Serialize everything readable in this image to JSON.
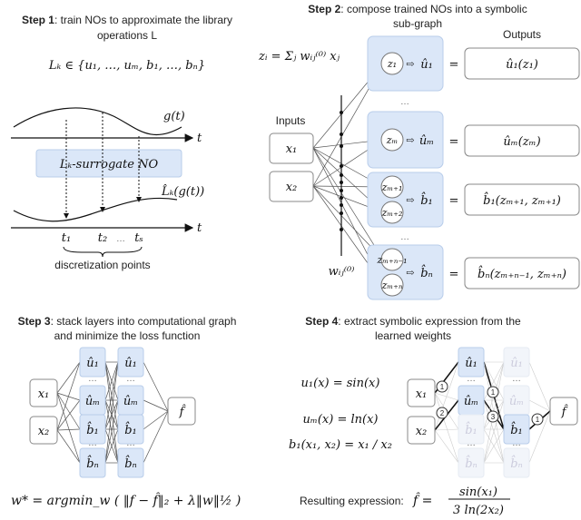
{
  "step1": {
    "title_bold": "Step 1",
    "title_rest": ": train NOs to approximate the library",
    "title_line2": "operations L",
    "library_set": "Lₖ ∈ {u₁, …, uₘ, b₁, …, bₙ}",
    "input_label": "g(t)",
    "axis_label": "t",
    "surrogate_label": "Lₖ-surrogate NO",
    "output_label": "L̂ₖ(g(t))",
    "ticks": [
      "t₁",
      "t₂",
      "…",
      "tₛ"
    ],
    "caption": "discretization points"
  },
  "step2": {
    "title_bold": "Step 2",
    "title_rest": ": compose trained NOs into a symbolic",
    "title_line2": "sub-graph",
    "formula": "zᵢ = Σⱼ wᵢⱼ⁽⁰⁾ xⱼ",
    "inputs_label": "Inputs",
    "outputs_label": "Outputs",
    "inputs": [
      "x₁",
      "x₂"
    ],
    "weight_label": "wᵢⱼ⁽⁰⁾",
    "ellipsis": "…",
    "equals": "=",
    "blocks": [
      {
        "nodes": [
          "z₁"
        ],
        "op": "û₁",
        "output": "û₁(z₁)"
      },
      {
        "nodes": [
          "zₘ"
        ],
        "op": "ûₘ",
        "output": "ûₘ(zₘ)"
      },
      {
        "nodes": [
          "zₘ₊₁",
          "zₘ₊₂"
        ],
        "op": "b̂₁",
        "output": "b̂₁(zₘ₊₁, zₘ₊₁)"
      },
      {
        "nodes": [
          "zₘ₊ₙ₋₁",
          "zₘ₊ₙ"
        ],
        "op": "b̂ₙ",
        "output": "b̂ₙ(zₘ₊ₙ₋₁, zₘ₊ₙ)"
      }
    ]
  },
  "step3": {
    "title_bold": "Step 3",
    "title_rest": ": stack layers into computational graph",
    "title_line2": "and minimize the loss function",
    "inputs": [
      "x₁",
      "x₂"
    ],
    "nodes": [
      "û₁",
      "…",
      "ûₘ",
      "b̂₁",
      "…",
      "b̂ₙ"
    ],
    "output": "f̂",
    "loss": "w* = argmin_w ( ‖f − f̂‖₂ + λ‖w‖½ )"
  },
  "step4": {
    "title_bold": "Step 4",
    "title_rest": ": extract symbolic expression from the",
    "title_line2": "learned weights",
    "equations": [
      "u₁(x) = sin(x)",
      "uₘ(x) = ln(x)",
      "b₁(x₁, x₂) = x₁ / x₂"
    ],
    "inputs": [
      "x₁",
      "x₂"
    ],
    "nodes": [
      "û₁",
      "…",
      "ûₘ",
      "b̂₁",
      "…",
      "b̂ₙ"
    ],
    "output": "f̂",
    "weights": [
      "1",
      "2",
      "1",
      "3",
      "1"
    ],
    "result_label": "Resulting expression:",
    "result_lhs": "f̂ =",
    "result_num": "sin(x₁)",
    "result_den": "3 ln(2x₂)"
  },
  "colors": {
    "block_fill": "#dbe7f8",
    "block_stroke": "#b8cdea"
  }
}
